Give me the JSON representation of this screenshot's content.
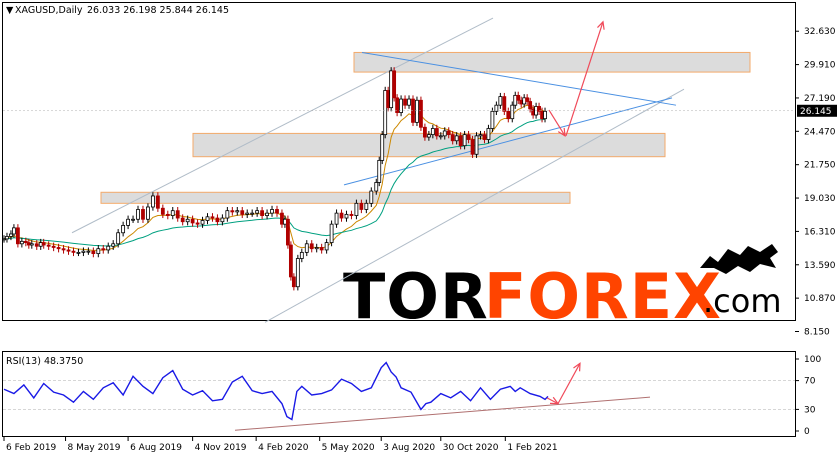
{
  "chart_data": [
    {
      "type": "candlestick",
      "header": {
        "symbol_tf": "XAGUSD,Daily",
        "ohlc": "26.033 26.198 25.844 26.145"
      },
      "ylim": [
        8.15,
        33.7
      ],
      "y_ticks": [
        "32.630",
        "29.910",
        "27.190",
        "24.470",
        "21.750",
        "19.030",
        "16.310",
        "13.590",
        "10.870",
        "8.150"
      ],
      "current_price": "26.145",
      "x_ticks": [
        "6 Feb 2019",
        "8 May 2019",
        "6 Aug 2019",
        "4 Nov 2019",
        "4 Feb 2020",
        "5 May 2020",
        "3 Aug 2020",
        "30 Oct 2020",
        "1 Feb 2021"
      ],
      "x": [
        0,
        3,
        7,
        10,
        14,
        18,
        22,
        25,
        28,
        33,
        37,
        40,
        45,
        50,
        55,
        60,
        65,
        70,
        75,
        80,
        85,
        90,
        95,
        100,
        105,
        110,
        115,
        120,
        125,
        130,
        135,
        140,
        145,
        150,
        155,
        160,
        165,
        170,
        175,
        180,
        185,
        190,
        195,
        200,
        205,
        210,
        215,
        220,
        225,
        230,
        235,
        240,
        245,
        250,
        255,
        260,
        265,
        270,
        275,
        280,
        283,
        286,
        289,
        292,
        296,
        300,
        305,
        310,
        315,
        320,
        325,
        330,
        335,
        340,
        345,
        350,
        355,
        360,
        365,
        370,
        375,
        378,
        381,
        384,
        387,
        390,
        393,
        396,
        400,
        404,
        408,
        412,
        416,
        420,
        424,
        428,
        432,
        436,
        440,
        444,
        448,
        452,
        456,
        460,
        464,
        468,
        472,
        476,
        480,
        484,
        488,
        492,
        496,
        500,
        504,
        508,
        512,
        515,
        518,
        521,
        524,
        527,
        530,
        533,
        536,
        539,
        542,
        545,
        548
      ],
      "close": [
        15.7,
        15.9,
        16.1,
        16.6,
        15.3,
        15.5,
        15.4,
        15.2,
        15.3,
        15.1,
        15.4,
        15.2,
        15.1,
        15.0,
        14.9,
        14.8,
        14.7,
        14.6,
        14.6,
        14.7,
        14.7,
        14.5,
        14.9,
        14.8,
        15.1,
        15.3,
        16.2,
        16.8,
        17.3,
        17.3,
        18.1,
        17.3,
        18.3,
        19.2,
        18.2,
        17.7,
        17.6,
        18.0,
        17.4,
        17.1,
        17.3,
        17.0,
        16.9,
        17.2,
        17.5,
        17.4,
        17.1,
        17.4,
        18.0,
        17.9,
        18.0,
        17.7,
        17.8,
        17.8,
        18.0,
        17.6,
        17.8,
        18.1,
        17.8,
        16.9,
        17.3,
        15.2,
        12.6,
        11.8,
        14.1,
        14.6,
        15.3,
        14.9,
        15.0,
        14.8,
        15.4,
        16.9,
        17.8,
        17.4,
        17.7,
        17.6,
        18.6,
        18.1,
        18.6,
        19.6,
        20.3,
        22.1,
        24.2,
        27.8,
        26.4,
        29.4,
        27.2,
        26.0,
        27.1,
        26.6,
        27.1,
        25.2,
        27.0,
        24.8,
        24.0,
        24.2,
        24.7,
        24.1,
        24.1,
        24.5,
        24.2,
        23.7,
        24.1,
        23.3,
        24.2,
        23.8,
        22.6,
        24.1,
        24.2,
        23.8,
        24.7,
        26.1,
        26.6,
        27.3,
        26.1,
        25.5,
        26.6,
        27.4,
        27.0,
        26.7,
        27.2,
        26.9,
        26.3,
        25.8,
        26.5,
        26.1,
        25.5,
        26.1
      ],
      "rsi": {
        "label": "RSI(13) 48.3750",
        "ylim": [
          0,
          100
        ],
        "ticks": [
          "100",
          "70",
          "30",
          "0"
        ],
        "x": [
          0,
          10,
          20,
          30,
          40,
          50,
          60,
          70,
          80,
          90,
          100,
          110,
          120,
          130,
          140,
          150,
          160,
          170,
          180,
          190,
          200,
          210,
          220,
          230,
          240,
          250,
          260,
          270,
          280,
          285,
          290,
          295,
          300,
          310,
          320,
          330,
          340,
          350,
          360,
          370,
          380,
          385,
          390,
          395,
          400,
          410,
          420,
          425,
          430,
          440,
          450,
          460,
          470,
          480,
          490,
          500,
          510,
          515,
          520,
          530,
          540,
          545,
          548
        ],
        "values": [
          58,
          52,
          64,
          46,
          66,
          54,
          50,
          40,
          55,
          44,
          60,
          67,
          50,
          76,
          62,
          52,
          74,
          84,
          58,
          50,
          56,
          42,
          44,
          68,
          76,
          56,
          52,
          55,
          38,
          20,
          16,
          55,
          62,
          50,
          52,
          57,
          72,
          66,
          55,
          60,
          88,
          95,
          82,
          75,
          60,
          54,
          30,
          38,
          40,
          52,
          46,
          55,
          42,
          60,
          44,
          58,
          62,
          55,
          60,
          52,
          48,
          44,
          48
        ]
      },
      "annotations": {
        "watermark_word": "TORFOREX",
        "watermark_suffix": ".com"
      }
    }
  ],
  "colors": {
    "bull": "#000000",
    "bear": "#b00000",
    "ma_fast": "#cc8800",
    "ma_slow": "#00a080",
    "channel": "#b0bcc8",
    "trend_blue": "#4a90e2",
    "zone_fill": "#d9d9d9",
    "zone_border": "#f2a15a",
    "arrow": "#f04a5a",
    "rsi_line": "#1a1ae6",
    "rsi_trend": "#b07070"
  }
}
